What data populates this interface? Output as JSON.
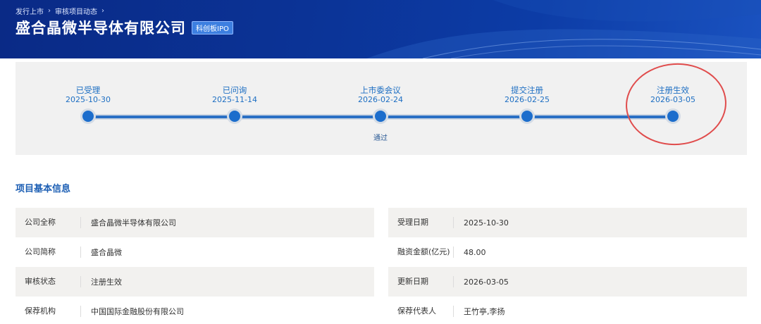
{
  "breadcrumb": [
    "发行上市",
    "审核项目动态"
  ],
  "breadcrumb_sep": "›",
  "company_title": "盛合晶微半导体有限公司",
  "board_badge": "科创板IPO",
  "timeline": {
    "stages": [
      {
        "name": "已受理",
        "date": "2025-10-30",
        "note": ""
      },
      {
        "name": "已问询",
        "date": "2025-11-14",
        "note": ""
      },
      {
        "name": "上市委会议",
        "date": "2026-02-24",
        "note": "通过"
      },
      {
        "name": "提交注册",
        "date": "2026-02-25",
        "note": ""
      },
      {
        "name": "注册生效",
        "date": "2026-03-05",
        "note": ""
      }
    ],
    "progress": 1.0,
    "colors": {
      "active": "#1c6dcc",
      "track": "#cfd8e3",
      "highlight_ring": "#e04c4c"
    }
  },
  "basic_info": {
    "title": "项目基本信息",
    "left": [
      {
        "label": "公司全称",
        "value": "盛合晶微半导体有限公司"
      },
      {
        "label": "公司简称",
        "value": "盛合晶微"
      },
      {
        "label": "审核状态",
        "value": "注册生效"
      },
      {
        "label": "保荐机构",
        "value": "中国国际金融股份有限公司"
      }
    ],
    "right": [
      {
        "label": "受理日期",
        "value": "2025-10-30"
      },
      {
        "label": "融资金额(亿元)",
        "value": "48.00"
      },
      {
        "label": "更新日期",
        "value": "2026-03-05"
      },
      {
        "label": "保荐代表人",
        "value": "王竹亭,李扬"
      }
    ]
  }
}
